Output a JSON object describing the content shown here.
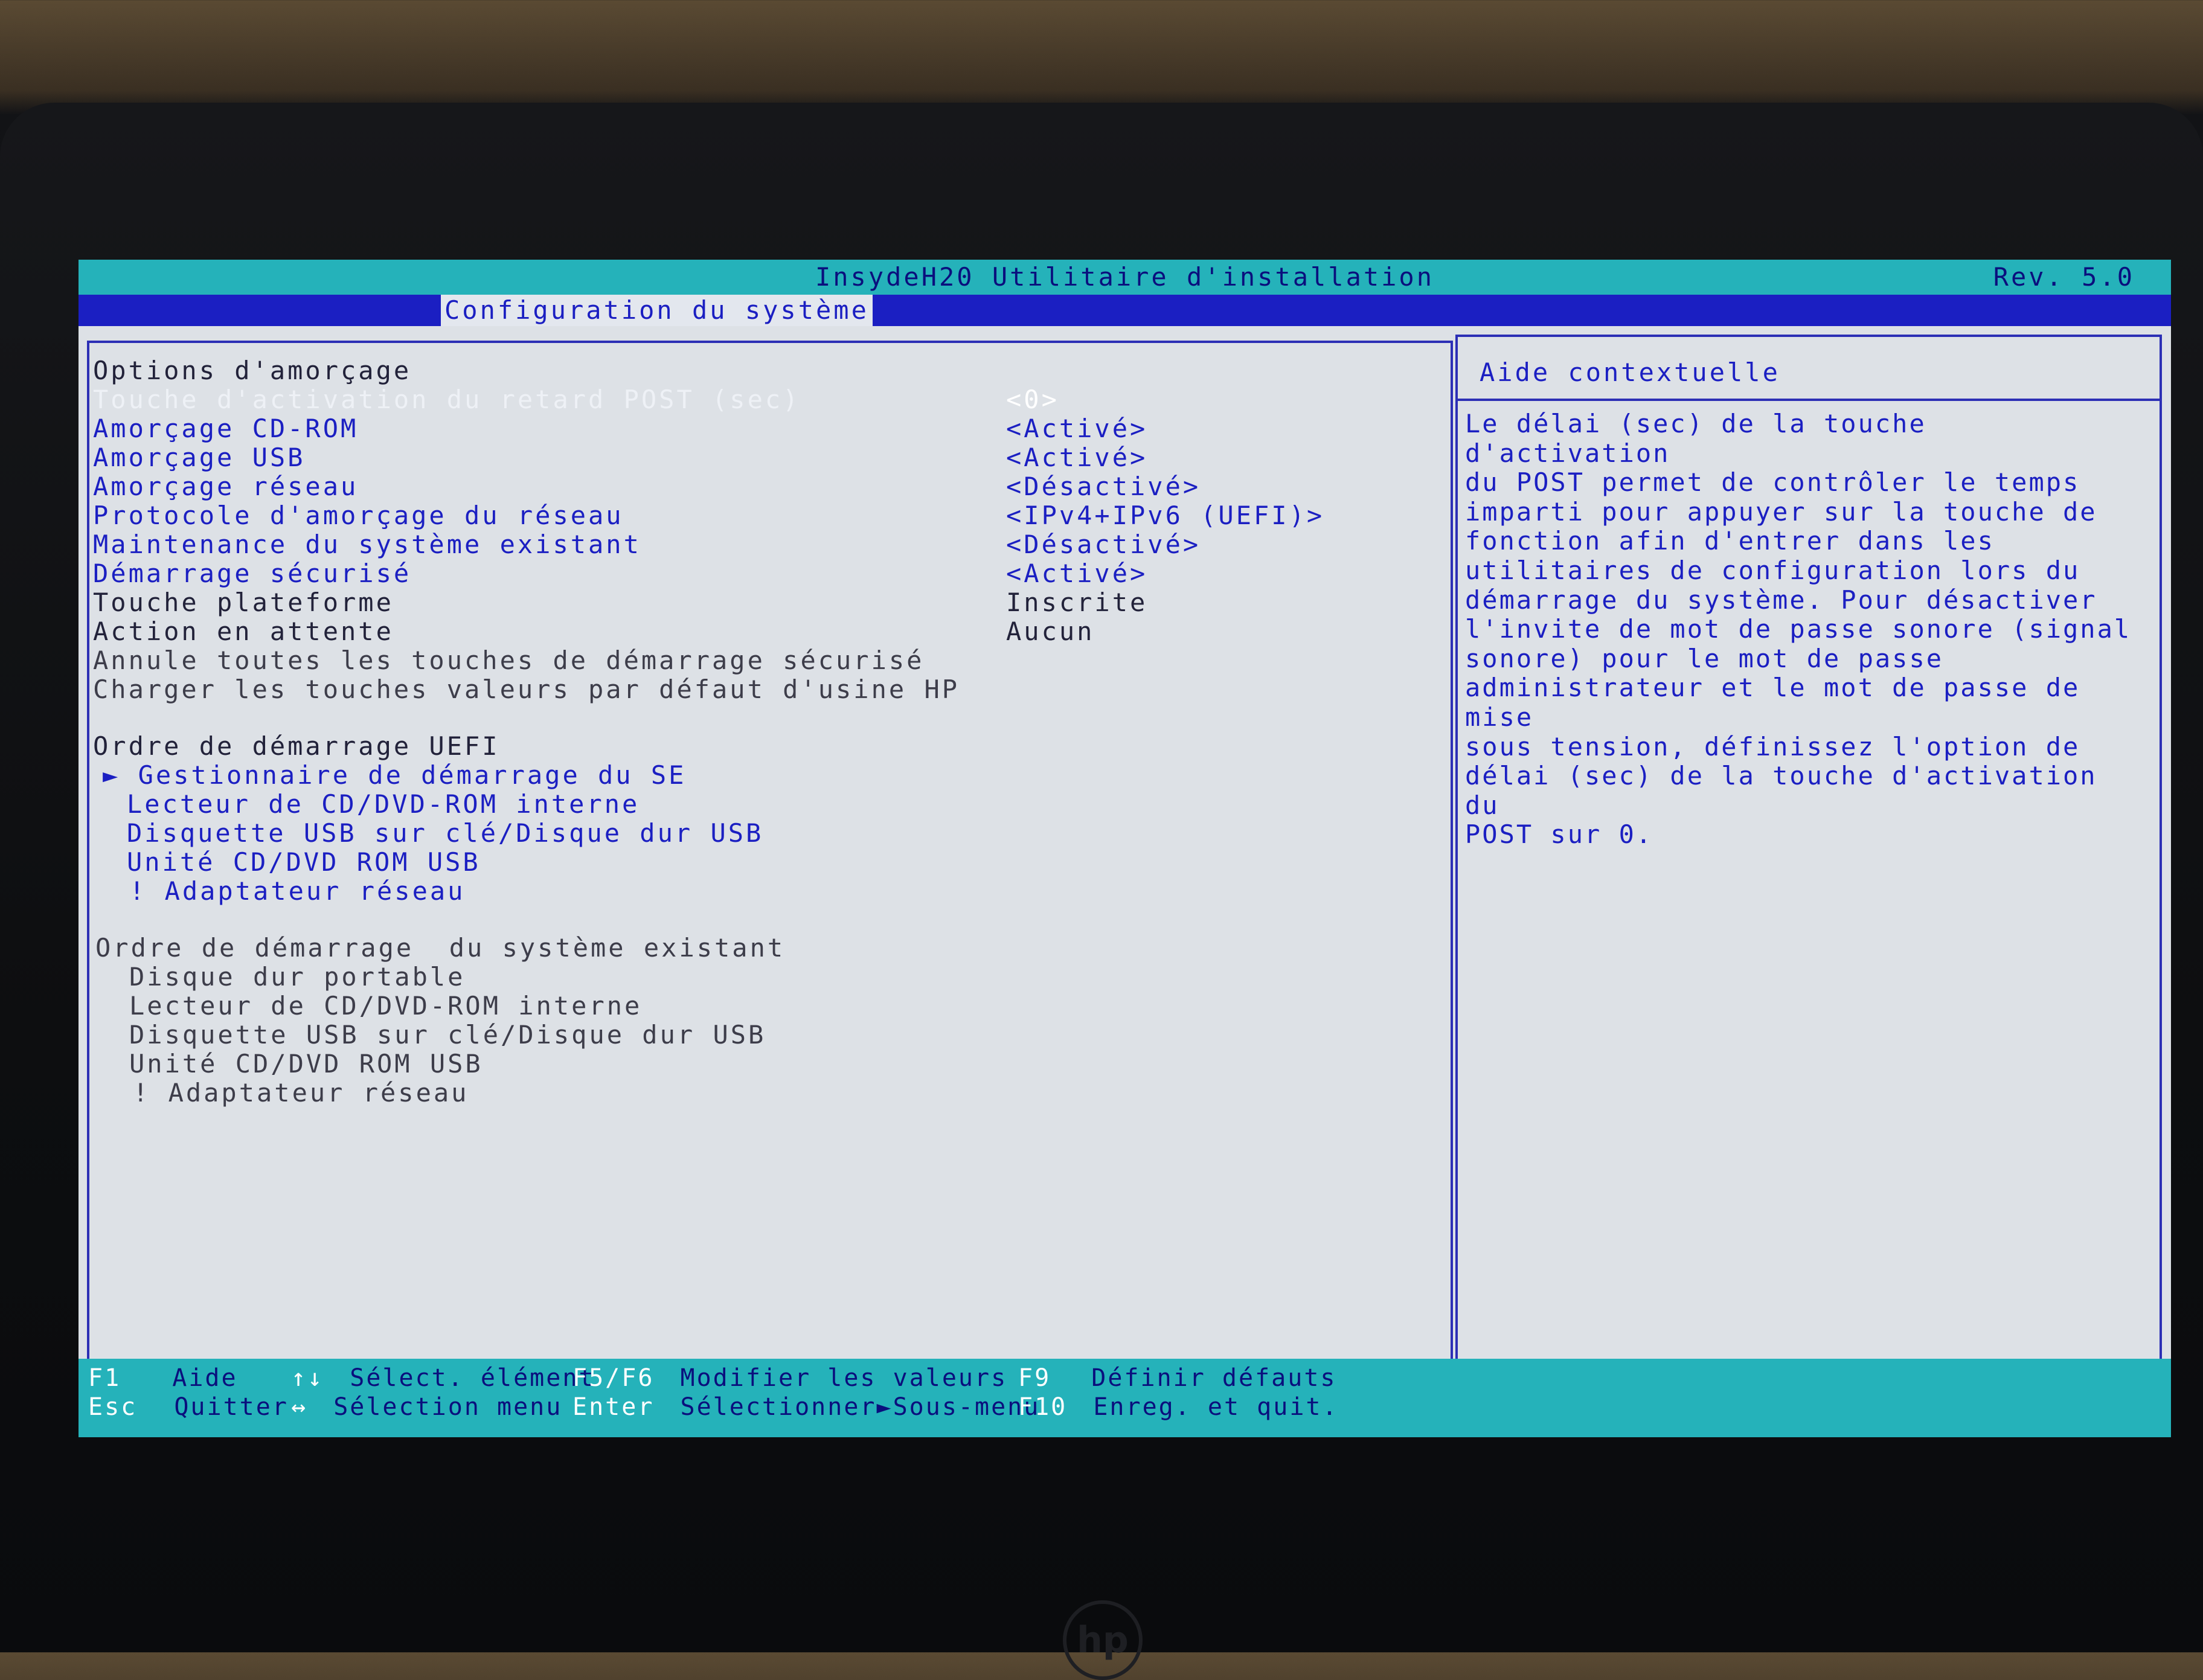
{
  "header": {
    "app_title": "InsydeH20 Utilitaire d'installation",
    "revision": "Rev. 5.0",
    "active_menu": "Configuration du système"
  },
  "boot_options": {
    "heading": "Options d'amorçage",
    "items": [
      {
        "label": "Touche d'activation du retard POST (sec)",
        "value": "<0>"
      },
      {
        "label": "Amorçage CD-ROM",
        "value": "<Activé>"
      },
      {
        "label": "Amorçage USB",
        "value": "<Activé>"
      },
      {
        "label": "Amorçage réseau",
        "value": "<Désactivé>"
      },
      {
        "label": "Protocole d'amorçage du réseau",
        "value": "<IPv4+IPv6 (UEFI)>"
      },
      {
        "label": "Maintenance du système existant",
        "value": "<Désactivé>"
      },
      {
        "label": "Démarrage sécurisé",
        "value": "<Activé>"
      },
      {
        "label": "Touche plateforme",
        "value": "Inscrite"
      },
      {
        "label": "Action en attente",
        "value": "Aucun"
      },
      {
        "label": "Annule toutes les touches de démarrage sécurisé",
        "value": ""
      },
      {
        "label": "Charger les touches valeurs par défaut d'usine HP",
        "value": ""
      }
    ]
  },
  "uefi_order": {
    "heading": "Ordre de démarrage UEFI",
    "items": [
      "► Gestionnaire de démarrage du SE",
      "Lecteur de CD/DVD-ROM interne",
      "Disquette USB sur clé/Disque dur USB",
      "Unité CD/DVD ROM USB",
      "! Adaptateur réseau"
    ]
  },
  "legacy_order": {
    "heading": "Ordre de démarrage  du système existant",
    "items": [
      "Disque dur portable",
      "Lecteur de CD/DVD-ROM interne",
      "Disquette USB sur clé/Disque dur USB",
      "Unité CD/DVD ROM USB",
      "! Adaptateur réseau"
    ]
  },
  "help": {
    "title": "Aide contextuelle",
    "text": "Le délai (sec) de la touche d'activation\ndu POST permet de contrôler le temps\nimparti pour appuyer sur la touche de\nfonction afin d'entrer dans les\nutilitaires de configuration lors du\ndémarrage du système. Pour désactiver\nl'invite de mot de passe sonore (signal\nsonore) pour le mot de passe\nadministrateur et le mot de passe de mise\nsous tension, définissez l'option de\ndélai (sec) de la touche d'activation du\nPOST sur 0."
  },
  "footer": {
    "f1_key": "F1",
    "f1_desc": "Aide",
    "esc_key": "Esc",
    "esc_desc": "Quitter",
    "updown_key": "↑↓",
    "updown_desc": "Sélect. élément",
    "leftright_key": "↔",
    "leftright_desc": "Sélection menu",
    "f5f6_key": "F5/F6",
    "f5f6_desc": "Modifier les valeurs",
    "enter_key": "Enter",
    "enter_desc": "Sélectionner►Sous-menu",
    "f9_key": "F9",
    "f9_desc": "Définir défauts",
    "f10_key": "F10",
    "f10_desc": "Enreg. et quit."
  },
  "colors": {
    "title_bar": "#25b2ba",
    "menu_bar": "#1b1fc2",
    "background": "#dde1e6",
    "text_blue": "#1b1fc2"
  }
}
